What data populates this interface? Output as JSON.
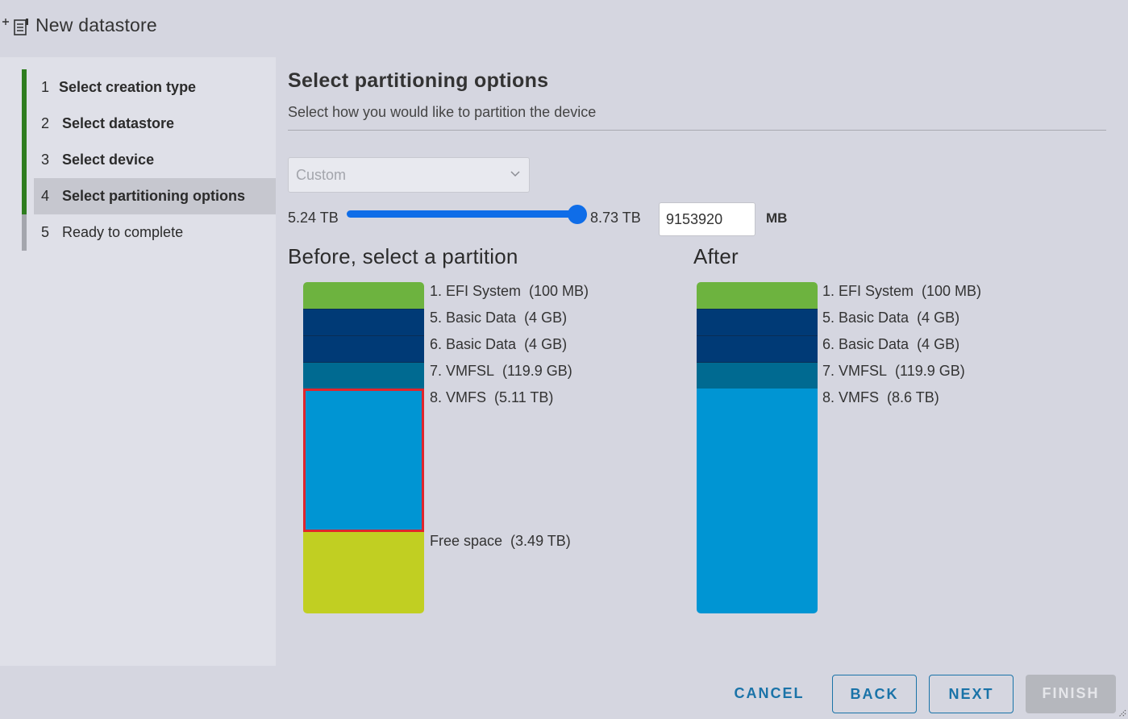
{
  "window": {
    "title": "New datastore",
    "icon": "add-datastore-icon"
  },
  "steps": [
    {
      "num": "1",
      "label": "Select creation type",
      "state": "done"
    },
    {
      "num": "2",
      "label": "Select datastore",
      "state": "done"
    },
    {
      "num": "3",
      "label": "Select device",
      "state": "done"
    },
    {
      "num": "4",
      "label": "Select partitioning options",
      "state": "active"
    },
    {
      "num": "5",
      "label": "Ready to complete",
      "state": "pending"
    }
  ],
  "page": {
    "title": "Select partitioning options",
    "subtitle": "Select how you would like to partition the device"
  },
  "partition_select": {
    "value": "Custom"
  },
  "size_slider": {
    "min_label": "5.24 TB",
    "max_label": "8.73 TB",
    "level": 1.0
  },
  "size_input": {
    "value": "9153920",
    "unit": "MB"
  },
  "before": {
    "title": "Before, select a partition",
    "partitions": [
      {
        "name": "1. EFI System",
        "size": "(100 MB)",
        "kind": "efi"
      },
      {
        "name": "5. Basic Data",
        "size": "(4 GB)",
        "kind": "basic"
      },
      {
        "name": "6. Basic Data",
        "size": "(4 GB)",
        "kind": "basic"
      },
      {
        "name": "7. VMFSL",
        "size": "(119.9 GB)",
        "kind": "vmfsl"
      },
      {
        "name": "8. VMFS",
        "size": "(5.11 TB)",
        "kind": "vmfs",
        "selected": true
      },
      {
        "name": "Free space",
        "size": "(3.49 TB)",
        "kind": "free"
      }
    ]
  },
  "after": {
    "title": "After",
    "partitions": [
      {
        "name": "1. EFI System",
        "size": "(100 MB)",
        "kind": "efi"
      },
      {
        "name": "5. Basic Data",
        "size": "(4 GB)",
        "kind": "basic"
      },
      {
        "name": "6. Basic Data",
        "size": "(4 GB)",
        "kind": "basic"
      },
      {
        "name": "7. VMFSL",
        "size": "(119.9 GB)",
        "kind": "vmfsl"
      },
      {
        "name": "8. VMFS",
        "size": "(8.6 TB)",
        "kind": "vmfs"
      }
    ]
  },
  "colors": {
    "efi": "#6db33f",
    "basic": "#003a76",
    "vmfsl": "#006a91",
    "vmfs": "#0095d3",
    "free": "#c1cf22",
    "selection": "#e0262c",
    "step_done": "#2e7d1f",
    "accent": "#1a73a8"
  },
  "footer": {
    "cancel": "CANCEL",
    "back": "BACK",
    "next": "NEXT",
    "finish": "FINISH"
  }
}
